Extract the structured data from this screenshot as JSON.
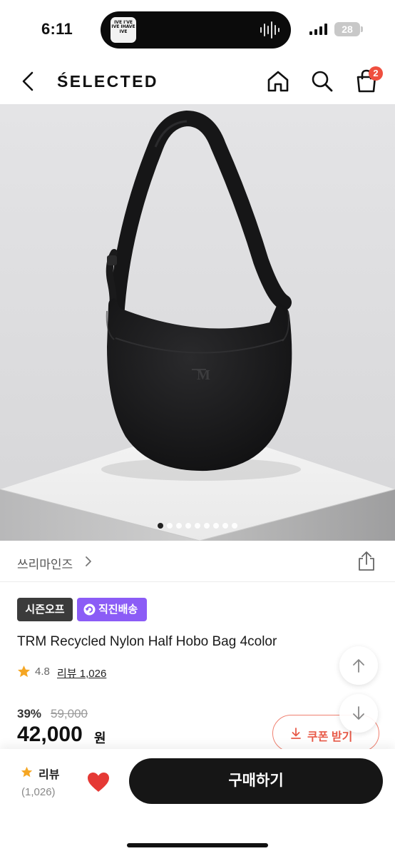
{
  "status_bar": {
    "time": "6:11",
    "battery": "28",
    "island_art_text": "IVE I'VE IVE IHAVE IVE"
  },
  "nav": {
    "brand": "ŚELECTED",
    "cart_count": "2"
  },
  "gallery": {
    "slide_count": 9,
    "active_index": 0
  },
  "brand": {
    "name": "쓰리마인즈"
  },
  "badges": {
    "season": "시즌오프",
    "direct": "직진배송"
  },
  "product": {
    "title": "TRM Recycled Nylon Half Hobo Bag 4color",
    "rating": "4.8",
    "review_text": "리뷰 1,026"
  },
  "price": {
    "discount": "39%",
    "original": "59,000",
    "current": "42,000",
    "unit": "원"
  },
  "coupon": {
    "label": "쿠폰 받기"
  },
  "bottom_bar": {
    "review_label": "리뷰",
    "review_count": "(1,026)",
    "buy_label": "구매하기",
    "liked": true
  },
  "colors": {
    "accent_purple": "#8b5cf6",
    "coupon_red": "#e85a48",
    "badge_dark": "#3b3b3b",
    "heart_red": "#e53935",
    "star_orange": "#f5a623",
    "buy_button": "#161616"
  }
}
